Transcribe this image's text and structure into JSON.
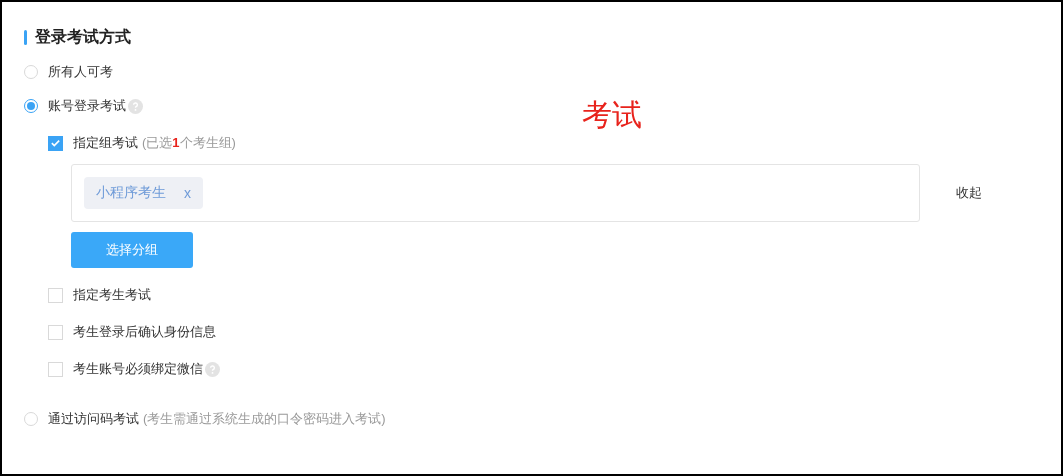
{
  "section": {
    "title": "登录考试方式"
  },
  "overlay_label": "考试",
  "options": [
    {
      "label": "所有人可考",
      "selected": false
    },
    {
      "label": "账号登录考试",
      "selected": true,
      "help": true,
      "sub_options": [
        {
          "kind": "group",
          "label": "指定组考试",
          "note": "(已选**1**个考生组)",
          "checked": true,
          "tags": [
            {
              "label": "小程序考生",
              "remove": "x"
            }
          ],
          "collapse": "收起",
          "button": "选择分组"
        },
        {
          "kind": "plain",
          "label": "指定考生考试",
          "checked": false
        },
        {
          "kind": "plain",
          "label": "考生登录后确认身份信息",
          "checked": false
        },
        {
          "kind": "plain",
          "label": "考生账号必须绑定微信",
          "checked": false,
          "help": true
        }
      ]
    },
    {
      "label": "通过访问码考试",
      "note": "(考生需通过系统生成的口令密码进入考试)",
      "selected": false
    }
  ]
}
